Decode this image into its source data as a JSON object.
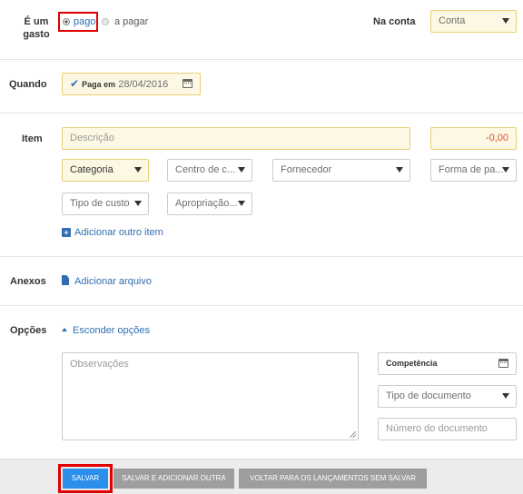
{
  "expense_row": {
    "label": "É um gasto",
    "status_options": [
      "pago",
      "a pagar"
    ],
    "account_label": "Na conta",
    "account_select": "Conta"
  },
  "when_row": {
    "label": "Quando",
    "paid_prefix": "Paga em",
    "date": "28/04/2016"
  },
  "item_row": {
    "label": "Item",
    "description_placeholder": "Descrição",
    "amount": "-0,00",
    "category": "Categoria",
    "cost_center": "Centro de c...",
    "supplier": "Fornecedor",
    "payment_method": "Forma de pa...",
    "cost_type": "Tipo de custo",
    "appropriation": "Apropriação...",
    "add_item_link": "Adicionar outro item"
  },
  "attachments_row": {
    "label": "Anexos",
    "add_file_link": "Adicionar arquivo"
  },
  "options_row": {
    "label": "Opções",
    "hide_options_link": "Esconder opções",
    "notes_placeholder": "Observações",
    "competence": "Competência",
    "document_type": "Tipo de documento",
    "document_number_placeholder": "Número do documento"
  },
  "footer": {
    "save": "SALVAR",
    "save_and_add": "SALVAR E ADICIONAR OUTRA",
    "back": "VOLTAR PARA OS LANÇAMENTOS SEM SALVAR"
  },
  "colors": {
    "accent_blue": "#2b8ee8",
    "highlight_red": "#e00000",
    "field_yellow": "#fdf8e3",
    "button_gray": "#9e9e9e"
  }
}
